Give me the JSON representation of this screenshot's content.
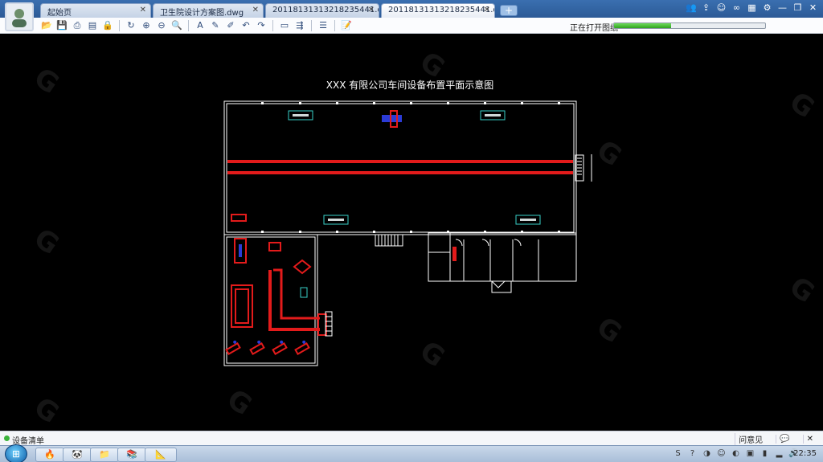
{
  "tabs": [
    {
      "label": "起始页",
      "active": false
    },
    {
      "label": "卫生院设计方案图.dwg",
      "active": false
    },
    {
      "label": "20118131313218235441.d...",
      "active": false
    },
    {
      "label": "20118131313218235441.d...",
      "active": true
    }
  ],
  "toolbar": {
    "status_text": "正在打开图纸",
    "progress": 0.38
  },
  "drawing": {
    "title": "XXX 有限公司车间设备布置平面示意图"
  },
  "statusbar": {
    "label": "设备清单",
    "feedback": "问意见"
  },
  "taskbar": {
    "time": "22:35"
  },
  "colors": {
    "tabbar": "#2c5a96",
    "canvas": "#000000",
    "wall": "#ffffff",
    "equipment_red": "#e31b1b",
    "cyan_label": "#37d0c8",
    "blue": "#2b3bd6",
    "progress_green": "#2fa31f"
  },
  "icons": [
    "user-avatar-icon",
    "close-icon",
    "add-tab-icon",
    "users-icon",
    "share-icon",
    "chat-icon",
    "link-icon",
    "apps-icon",
    "settings-icon",
    "minimize-icon",
    "restore-icon",
    "window-close-icon"
  ]
}
